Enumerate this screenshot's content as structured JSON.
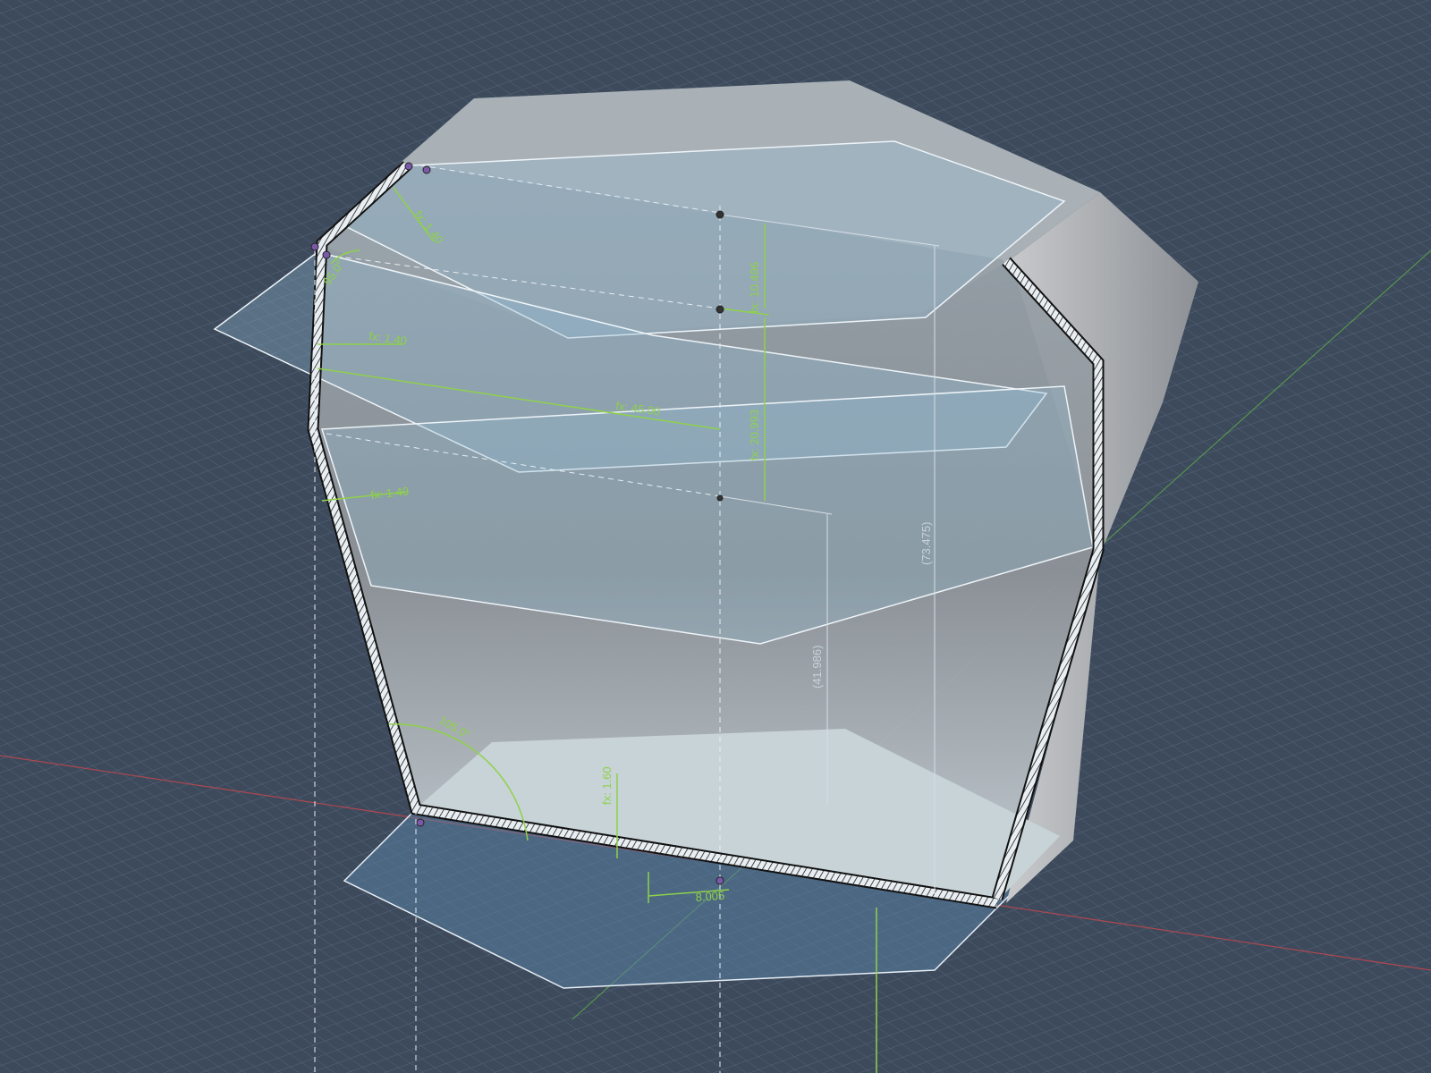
{
  "viewport": {
    "background": "#3d4a5c",
    "grid_color": "#56657a",
    "accent_dimension": "#8fd14a",
    "x_axis_color": "#b0474f",
    "y_axis_color": "#5aa04a"
  },
  "dimensions": {
    "wall_top": "fx: 1.40",
    "angle_top": "95.0°",
    "wall_mid": "fx: 1.40",
    "width": "fx: 45.00",
    "wall_low": "fx: 1.40",
    "height_top": "fx: 10.496",
    "height_mid": "fx: 20.993",
    "ref_total": "(73.475)",
    "ref_lower": "(41.986)",
    "angle_bottom": "105.0°",
    "floor_thickness": "fx: 1.60",
    "slot_width": "8.005"
  }
}
